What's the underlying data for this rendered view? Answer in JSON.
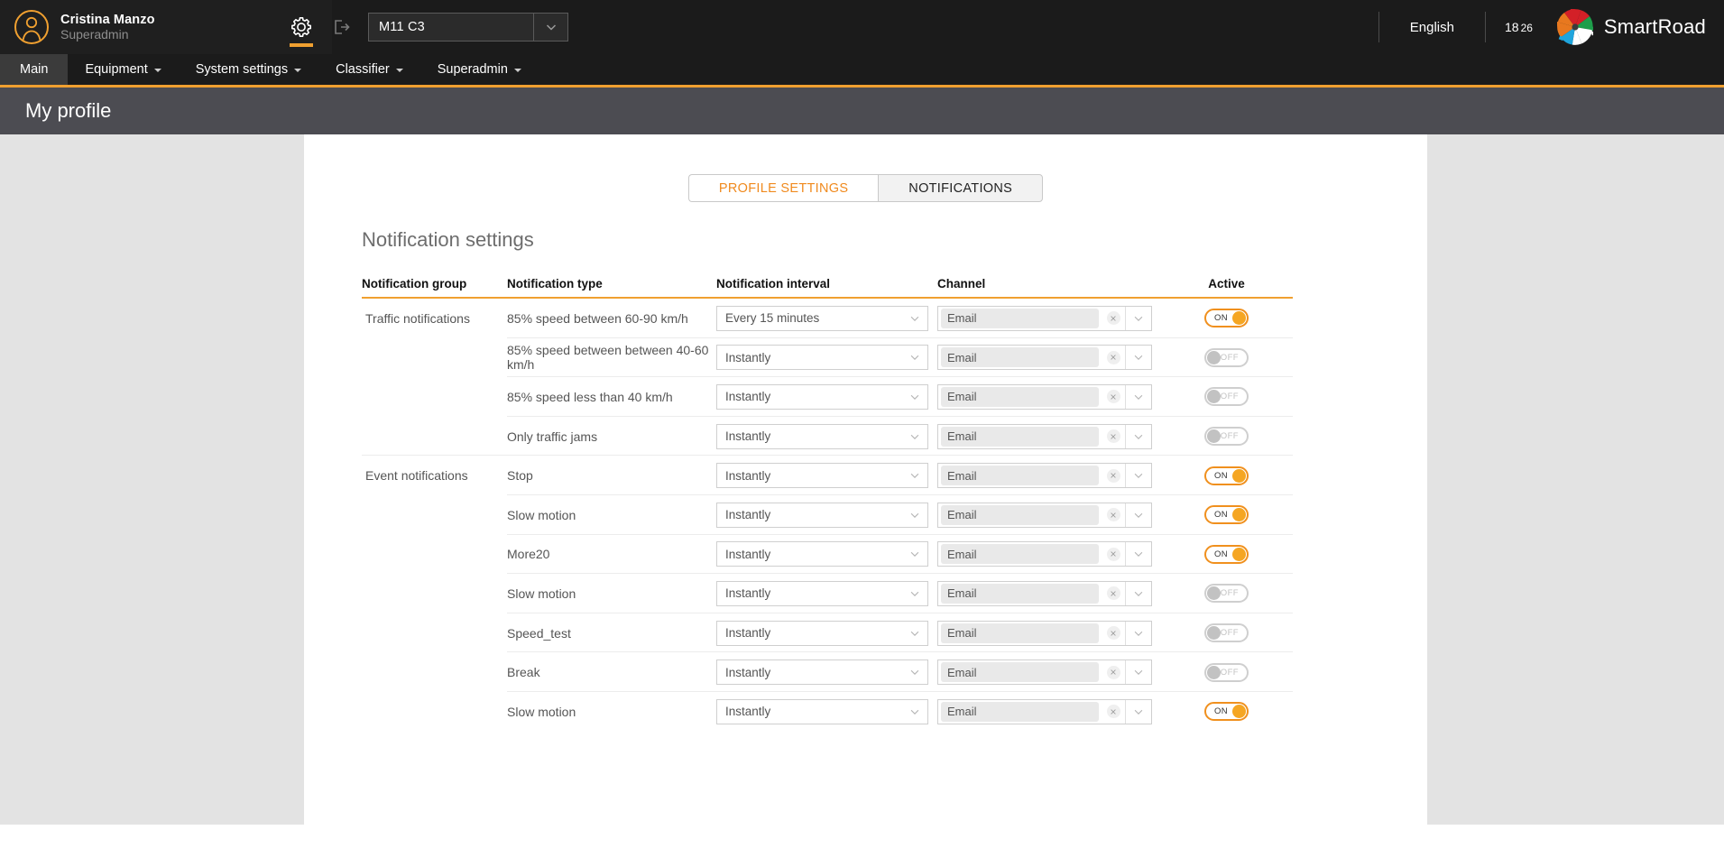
{
  "header": {
    "user_name": "Cristina Manzo",
    "user_role": "Superadmin",
    "site_select_value": "M11 C3",
    "language": "English",
    "time_hours": "18",
    "time_minutes": "26",
    "brand_name": "SmartRoad",
    "accent_color": "#f0a030"
  },
  "nav": {
    "items": [
      {
        "label": "Main",
        "has_caret": false,
        "active": true
      },
      {
        "label": "Equipment",
        "has_caret": true,
        "active": false
      },
      {
        "label": "System settings",
        "has_caret": true,
        "active": false
      },
      {
        "label": "Classifier",
        "has_caret": true,
        "active": false
      },
      {
        "label": "Superadmin",
        "has_caret": true,
        "active": false
      }
    ]
  },
  "page": {
    "title": "My profile"
  },
  "tabs": [
    {
      "label": "PROFILE SETTINGS",
      "active": true
    },
    {
      "label": "NOTIFICATIONS",
      "active": false
    }
  ],
  "content": {
    "section_title": "Notification settings",
    "columns": {
      "group": "Notification group",
      "type": "Notification type",
      "interval": "Notification interval",
      "channel": "Channel",
      "active": "Active"
    },
    "rows": [
      {
        "group": "Traffic notifications",
        "type": "85% speed between 60-90 km/h",
        "interval": "Every 15 minutes",
        "channel": "Email",
        "active": "ON",
        "first_in_group": true
      },
      {
        "group": "",
        "type": "85% speed between between 40-60 km/h",
        "interval": "Instantly",
        "channel": "Email",
        "active": "OFF",
        "first_in_group": false
      },
      {
        "group": "",
        "type": "85% speed less than 40 km/h",
        "interval": "Instantly",
        "channel": "Email",
        "active": "OFF",
        "first_in_group": false
      },
      {
        "group": "",
        "type": "Only traffic jams",
        "interval": "Instantly",
        "channel": "Email",
        "active": "OFF",
        "first_in_group": false
      },
      {
        "group": "Event notifications",
        "type": "Stop",
        "interval": "Instantly",
        "channel": "Email",
        "active": "ON",
        "first_in_group": true
      },
      {
        "group": "",
        "type": "Slow motion",
        "interval": "Instantly",
        "channel": "Email",
        "active": "ON",
        "first_in_group": false
      },
      {
        "group": "",
        "type": "More20",
        "interval": "Instantly",
        "channel": "Email",
        "active": "ON",
        "first_in_group": false
      },
      {
        "group": "",
        "type": "Slow motion",
        "interval": "Instantly",
        "channel": "Email",
        "active": "OFF",
        "first_in_group": false
      },
      {
        "group": "",
        "type": "Speed_test",
        "interval": "Instantly",
        "channel": "Email",
        "active": "OFF",
        "first_in_group": false
      },
      {
        "group": "",
        "type": "Break",
        "interval": "Instantly",
        "channel": "Email",
        "active": "OFF",
        "first_in_group": false
      },
      {
        "group": "",
        "type": "Slow motion",
        "interval": "Instantly",
        "channel": "Email",
        "active": "ON",
        "first_in_group": false
      }
    ]
  }
}
